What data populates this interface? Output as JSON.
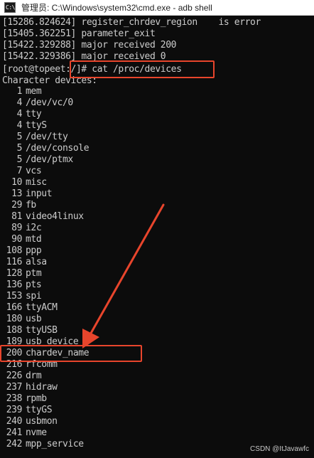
{
  "window": {
    "icon_text": "C:\\.",
    "title": "管理员: C:\\Windows\\system32\\cmd.exe - adb  shell"
  },
  "console": {
    "log_lines": [
      "[15286.824624] register_chrdev_region    is error",
      "[15405.362251] parameter_exit",
      "[15422.329288] major received 200",
      "[15422.329386] major received 0"
    ],
    "prompt_line": "[root@topeet:/]# cat /proc/devices",
    "header": "Character devices:",
    "devices": [
      {
        "major": "1",
        "name": "mem"
      },
      {
        "major": "4",
        "name": "/dev/vc/0"
      },
      {
        "major": "4",
        "name": "tty"
      },
      {
        "major": "4",
        "name": "ttyS"
      },
      {
        "major": "5",
        "name": "/dev/tty"
      },
      {
        "major": "5",
        "name": "/dev/console"
      },
      {
        "major": "5",
        "name": "/dev/ptmx"
      },
      {
        "major": "7",
        "name": "vcs"
      },
      {
        "major": "10",
        "name": "misc"
      },
      {
        "major": "13",
        "name": "input"
      },
      {
        "major": "29",
        "name": "fb"
      },
      {
        "major": "81",
        "name": "video4linux"
      },
      {
        "major": "89",
        "name": "i2c"
      },
      {
        "major": "90",
        "name": "mtd"
      },
      {
        "major": "108",
        "name": "ppp"
      },
      {
        "major": "116",
        "name": "alsa"
      },
      {
        "major": "128",
        "name": "ptm"
      },
      {
        "major": "136",
        "name": "pts"
      },
      {
        "major": "153",
        "name": "spi"
      },
      {
        "major": "166",
        "name": "ttyACM"
      },
      {
        "major": "180",
        "name": "usb"
      },
      {
        "major": "188",
        "name": "ttyUSB"
      },
      {
        "major": "189",
        "name": "usb_device"
      },
      {
        "major": "200",
        "name": "chardev_name"
      },
      {
        "major": "216",
        "name": "rfcomm"
      },
      {
        "major": "226",
        "name": "drm"
      },
      {
        "major": "237",
        "name": "hidraw"
      },
      {
        "major": "238",
        "name": "rpmb"
      },
      {
        "major": "239",
        "name": "ttyGS"
      },
      {
        "major": "240",
        "name": "usbmon"
      },
      {
        "major": "241",
        "name": "nvme"
      },
      {
        "major": "242",
        "name": "mpp_service"
      }
    ]
  },
  "watermark": "CSDN @ItJavawfc",
  "colors": {
    "terminal_bg": "#0c0c0c",
    "terminal_text": "#cccccc",
    "annotation": "#e8452c",
    "titlebar_bg": "#ffffff"
  }
}
